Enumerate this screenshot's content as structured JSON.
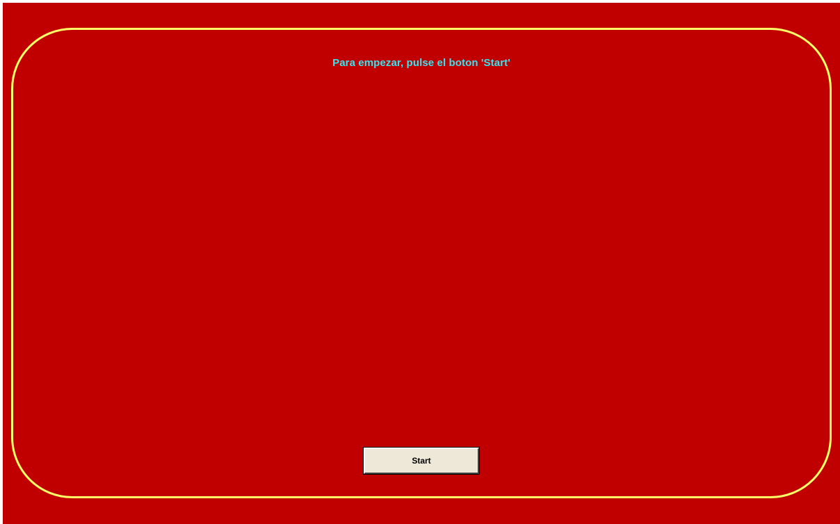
{
  "game": {
    "instruction": "Para empezar, pulse el boton 'Start'",
    "start_label": "Start"
  },
  "colors": {
    "felt": "#c00000",
    "border": "#ffff66",
    "instruction_text": "#33e6f0",
    "button_face": "#ede8d8"
  }
}
